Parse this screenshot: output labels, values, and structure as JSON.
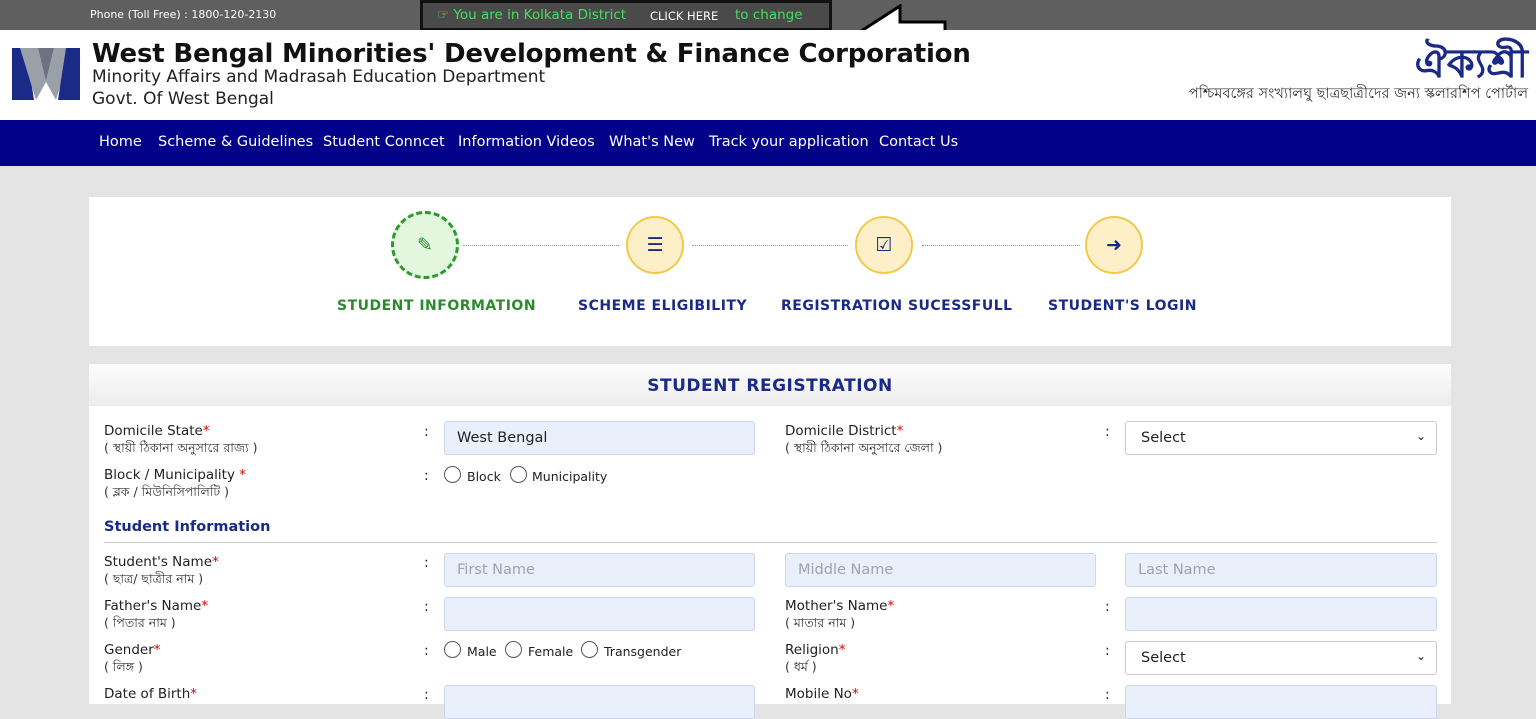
{
  "topbar": {
    "phone": "Phone (Toll Free) : 1800-120-2130",
    "district_msg": "☞ You are in Kolkata District",
    "click_here": "CLICK HERE",
    "to_change": "to change"
  },
  "header": {
    "org_title": "West Bengal Minorities' Development & Finance Corporation",
    "org_sub1": "Minority Affairs and Madrasah Education Department",
    "org_sub2": "Govt. Of West Bengal",
    "brand": "ঐক্যশ্রী",
    "tagline": "পশ্চিমবঙ্গের সংখ্যালঘু ছাত্রছাত্রীদের জন্য স্কলারশিপ পোর্টাল"
  },
  "nav": {
    "items": [
      "Home",
      "Scheme & Guidelines",
      "Student Conncet",
      "Information Videos",
      "What's New",
      "Track your application",
      "Contact Us"
    ]
  },
  "steps": [
    {
      "label": "STUDENT INFORMATION",
      "icon": "edit-icon",
      "glyph": "✎",
      "active": true
    },
    {
      "label": "SCHEME ELIGIBILITY",
      "icon": "document-icon",
      "glyph": "☰",
      "active": false
    },
    {
      "label": "REGISTRATION SUCESSFULL",
      "icon": "check-square-icon",
      "glyph": "☑",
      "active": false
    },
    {
      "label": "STUDENT'S LOGIN",
      "icon": "sign-in-icon",
      "glyph": "➜",
      "active": false
    }
  ],
  "form": {
    "title": "STUDENT REGISTRATION",
    "colon": ":",
    "required_mark": "*",
    "domicile_state": {
      "label": "Domicile State",
      "sub": "( স্থায়ী ঠিকানা অনুসারে রাজ্য )",
      "value": "West Bengal"
    },
    "domicile_district": {
      "label": "Domicile District",
      "sub": "( স্থায়ী ঠিকানা অনুসারে জেলা )",
      "value": "Select"
    },
    "block_municipality": {
      "label": "Block / Municipality ",
      "sub": "( ব্লক / মিউনিসিপালিটি )",
      "options": [
        "Block",
        "Municipality"
      ]
    },
    "section_student": "Student Information",
    "student_name": {
      "label": "Student's Name",
      "sub": "( ছাত্র/ ছাত্রীর নাম )",
      "first_ph": "First Name",
      "middle_ph": "Middle Name",
      "last_ph": "Last Name"
    },
    "father_name": {
      "label": "Father's Name",
      "sub": "( পিতার নাম )"
    },
    "mother_name": {
      "label": "Mother's Name",
      "sub": "( মাতার নাম )"
    },
    "gender": {
      "label": "Gender",
      "sub": "( লিঙ্গ )",
      "options": [
        "Male",
        "Female",
        "Transgender"
      ]
    },
    "religion": {
      "label": "Religion",
      "sub": "( ধর্ম )",
      "value": "Select"
    },
    "dob": {
      "label": "Date of Birth"
    },
    "mobile": {
      "label": "Mobile No"
    }
  }
}
